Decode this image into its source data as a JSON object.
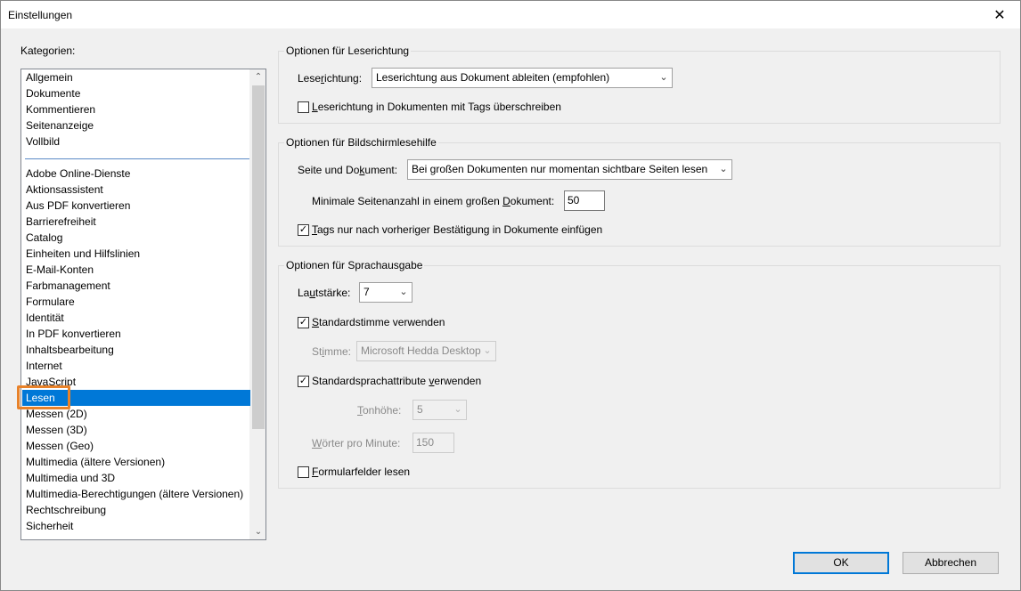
{
  "window": {
    "title": "Einstellungen",
    "close": "✕"
  },
  "categories": {
    "label": "Kategorien:",
    "group1": [
      "Allgemein",
      "Dokumente",
      "Kommentieren",
      "Seitenanzeige",
      "Vollbild"
    ],
    "group2": [
      "Adobe Online-Dienste",
      "Aktionsassistent",
      "Aus PDF konvertieren",
      "Barrierefreiheit",
      "Catalog",
      "Einheiten und Hilfslinien",
      "E-Mail-Konten",
      "Farbmanagement",
      "Formulare",
      "Identität",
      "In PDF konvertieren",
      "Inhaltsbearbeitung",
      "Internet",
      "JavaScript",
      "Lesen",
      "Messen (2D)",
      "Messen (3D)",
      "Messen (Geo)",
      "Multimedia (ältere Versionen)",
      "Multimedia und 3D",
      "Multimedia-Berechtigungen (ältere Versionen)",
      "Rechtschreibung",
      "Sicherheit"
    ],
    "selected": "Lesen",
    "highlight_color": "#e8822a",
    "selection_color": "#0078d7"
  },
  "reading_order": {
    "legend": "Optionen für Leserichtung",
    "label_pre": "Lese",
    "label_u": "r",
    "label_post": "ichtung:",
    "value": "Leserichtung aus Dokument ableiten (empfohlen)",
    "override_pre": "",
    "override_u": "L",
    "override_post": "eserichtung in Dokumenten mit Tags überschreiben",
    "override_checked": false
  },
  "screen_reader": {
    "legend": "Optionen für Bildschirmlesehilfe",
    "page_label_pre": "Seite und Do",
    "page_label_u": "k",
    "page_label_post": "ument:",
    "page_value": "Bei großen Dokumenten nur momentan sichtbare Seiten lesen",
    "min_pages_pre": "Minimale Seitenanzahl in einem großen ",
    "min_pages_u": "D",
    "min_pages_post": "okument:",
    "min_pages_value": "50",
    "tags_pre": "",
    "tags_u": "T",
    "tags_post": "ags nur nach vorheriger Bestätigung in Dokumente einfügen",
    "tags_checked": true
  },
  "speech": {
    "legend": "Optionen für Sprachausgabe",
    "volume_pre": "La",
    "volume_u": "u",
    "volume_post": "tstärke:",
    "volume_value": "7",
    "default_voice_pre": "",
    "default_voice_u": "S",
    "default_voice_post": "tandardstimme verwenden",
    "default_voice_checked": true,
    "voice_pre": "St",
    "voice_u": "i",
    "voice_post": "mme:",
    "voice_value": "Microsoft Hedda Desktop",
    "default_attr_pre": "Standardsprachattribute ",
    "default_attr_u": "v",
    "default_attr_post": "erwenden",
    "default_attr_checked": true,
    "pitch_pre": "",
    "pitch_u": "T",
    "pitch_post": "onhöhe:",
    "pitch_value": "5",
    "wpm_pre": "",
    "wpm_u": "W",
    "wpm_post": "örter pro Minute:",
    "wpm_value": "150",
    "form_fields_pre": "",
    "form_fields_u": "F",
    "form_fields_post": "ormularfelder lesen",
    "form_fields_checked": false
  },
  "buttons": {
    "ok": "OK",
    "cancel": "Abbrechen"
  },
  "icons": {
    "check": "✓",
    "dropdown": "⌄",
    "scroll_up": "⌃",
    "scroll_down": "⌄"
  }
}
